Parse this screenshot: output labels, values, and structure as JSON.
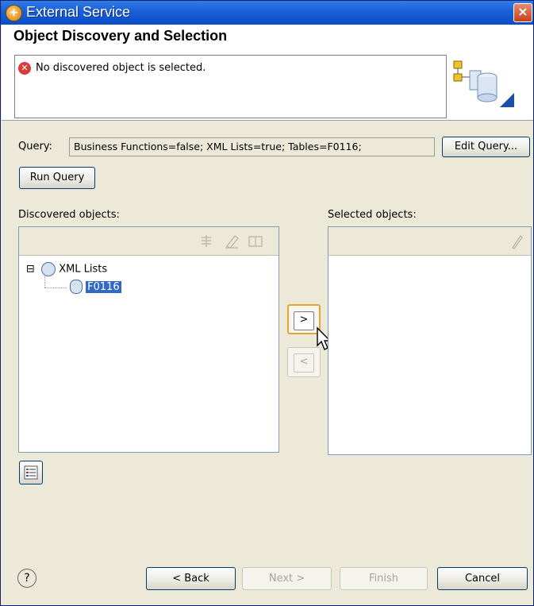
{
  "window": {
    "title": "External Service",
    "close_label": "×"
  },
  "header": {
    "title": "Object Discovery and Selection",
    "message": "No discovered object is selected."
  },
  "query": {
    "label": "Query:",
    "value": "Business Functions=false; XML Lists=true; Tables=F0116;",
    "edit_label": "Edit Query...",
    "run_label": "Run Query"
  },
  "discovered": {
    "label": "Discovered objects:",
    "tree": [
      {
        "label": "XML Lists",
        "expanded": true,
        "expander": "⊟"
      },
      {
        "label": "F0116",
        "selected": true
      }
    ]
  },
  "selected": {
    "label": "Selected objects:"
  },
  "transfer": {
    "add_label": ">",
    "remove_label": "<"
  },
  "footer": {
    "help_label": "?",
    "back_label": "< Back",
    "next_label": "Next >",
    "finish_label": "Finish",
    "cancel_label": "Cancel"
  },
  "colors": {
    "titlebar": "#1a5fd8",
    "selection": "#316ac5",
    "error": "#d93b3b"
  }
}
